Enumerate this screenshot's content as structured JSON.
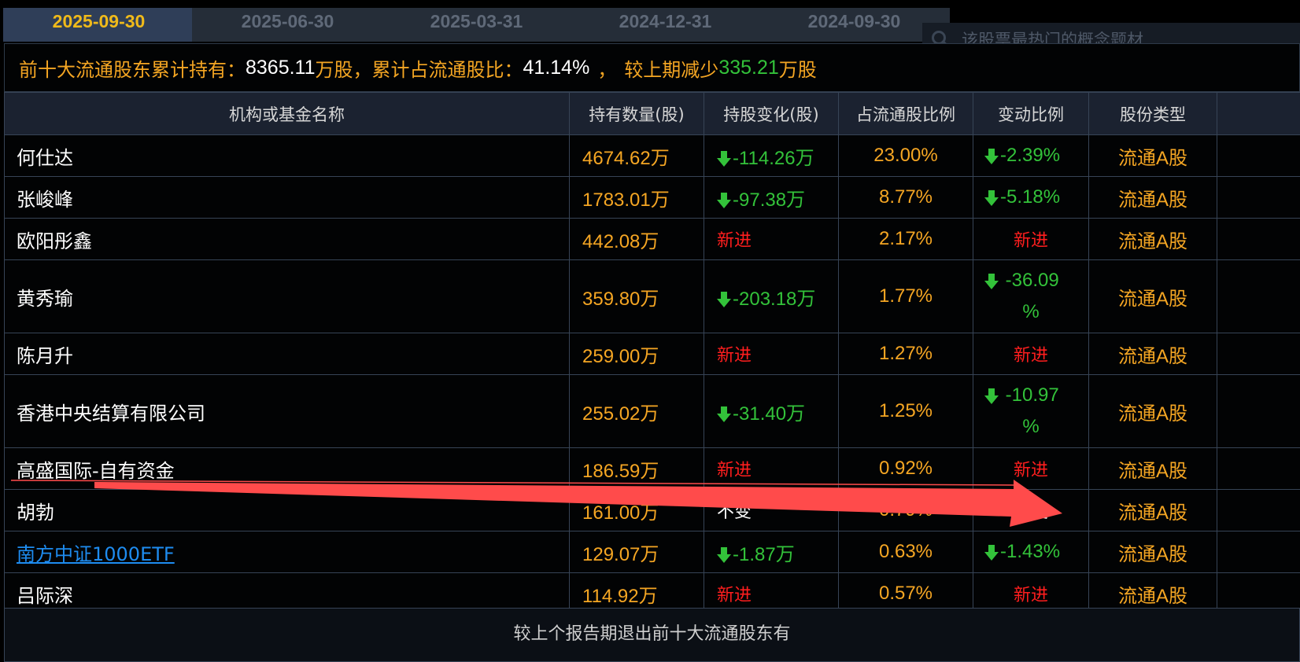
{
  "tabs": [
    "2025-09-30",
    "2025-06-30",
    "2025-03-31",
    "2024-12-31",
    "2024-09-30"
  ],
  "active_tab": 0,
  "search": {
    "placeholder": "该股票最热门的概念题材"
  },
  "summary": {
    "label1": "前十大流通股东累计持有：",
    "value1": "8365.11",
    "unit1": "万股，",
    "label2": "累计占流通股比：",
    "value2": "41.14%",
    "sep": "，",
    "label3": "较上期减少",
    "value3": "335.21",
    "unit3": "万股"
  },
  "columns": [
    "机构或基金名称",
    "持有数量(股)",
    "持股变化(股)",
    "占流通股比例",
    "变动比例",
    "股份类型"
  ],
  "rows": [
    {
      "name": "何仕达",
      "qty": "4674.62万",
      "change": "-114.26万",
      "change_type": "down",
      "pct": "23.00%",
      "ratio": "-2.39%",
      "ratio_type": "down",
      "type": "流通A股"
    },
    {
      "name": "张峻峰",
      "qty": "1783.01万",
      "change": "-97.38万",
      "change_type": "down",
      "pct": "8.77%",
      "ratio": "-5.18%",
      "ratio_type": "down",
      "type": "流通A股"
    },
    {
      "name": "欧阳彤鑫",
      "qty": "442.08万",
      "change": "新进",
      "change_type": "new",
      "pct": "2.17%",
      "ratio": "新进",
      "ratio_type": "new",
      "type": "流通A股"
    },
    {
      "name": "黄秀瑜",
      "qty": "359.80万",
      "change": "-203.18万",
      "change_type": "down",
      "pct": "1.77%",
      "ratio": "-36.09%",
      "ratio_line1": " -36.09",
      "ratio_line2": "%",
      "ratio_type": "down-wrap",
      "type": "流通A股"
    },
    {
      "name": "陈月升",
      "qty": "259.00万",
      "change": "新进",
      "change_type": "new",
      "pct": "1.27%",
      "ratio": "新进",
      "ratio_type": "new",
      "type": "流通A股"
    },
    {
      "name": "香港中央结算有限公司",
      "qty": "255.02万",
      "change": "-31.40万",
      "change_type": "down",
      "pct": "1.25%",
      "ratio": "-10.97%",
      "ratio_line1": " -10.97",
      "ratio_line2": "%",
      "ratio_type": "down-wrap",
      "type": "流通A股"
    },
    {
      "name": "高盛国际-自有资金",
      "qty": "186.59万",
      "change": "新进",
      "change_type": "new",
      "pct": "0.92%",
      "ratio": "新进",
      "ratio_type": "new",
      "type": "流通A股"
    },
    {
      "name": "胡勃",
      "qty": "161.00万",
      "change": "不变",
      "change_type": "same",
      "pct": "0.79%",
      "ratio": "不变",
      "ratio_type": "same",
      "type": "流通A股"
    },
    {
      "name": "南方中证1000ETF",
      "name_link": true,
      "qty": "129.07万",
      "change": "-1.87万",
      "change_type": "down",
      "pct": "0.63%",
      "ratio": "-1.43%",
      "ratio_type": "down",
      "type": "流通A股"
    },
    {
      "name": "吕际深",
      "qty": "114.92万",
      "change": "新进",
      "change_type": "new",
      "pct": "0.57%",
      "ratio": "新进",
      "ratio_type": "new",
      "type": "流通A股"
    }
  ],
  "footer": {
    "text": "较上个报告期退出前十大流通股东有"
  },
  "colors": {
    "accent": "#f5a623",
    "up": "#ff1e1e",
    "down": "#33c23a",
    "link": "#1e8cf0",
    "annotation_arrow": "#ff4b4b"
  },
  "icons": {
    "search": "search-icon",
    "down_arrow": "down-arrow-icon"
  }
}
